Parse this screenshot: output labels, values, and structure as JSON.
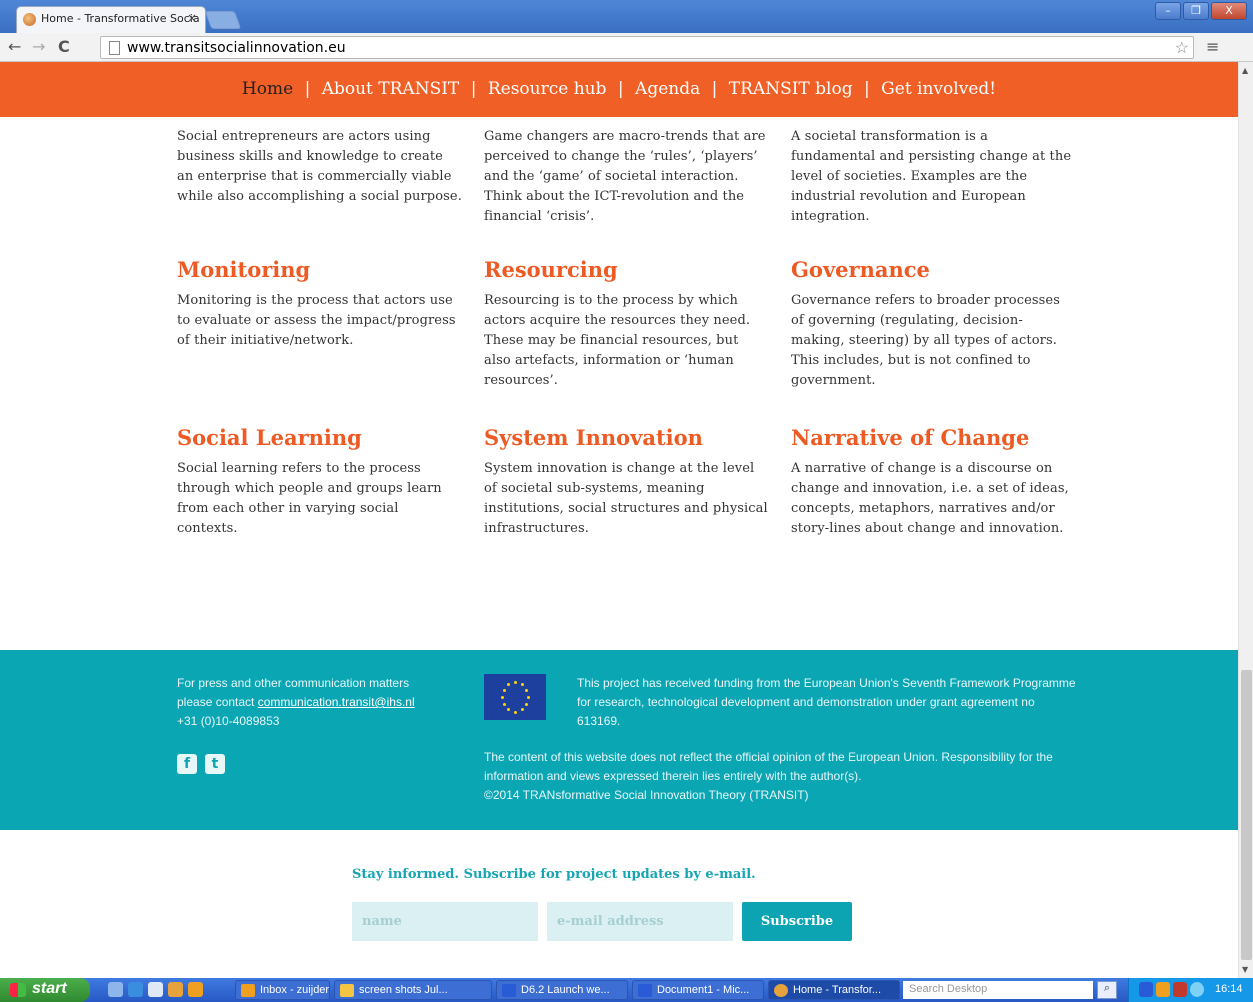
{
  "browser": {
    "tab_title": "Home - Transformative Socia",
    "tab_close": "×",
    "url": "www.transitsocialinnovation.eu",
    "back": "←",
    "forward": "→",
    "reload": "C",
    "star": "☆",
    "menu": "≡",
    "window_minimize": "–",
    "window_restore": "❐",
    "window_close": "X"
  },
  "nav": {
    "items": [
      {
        "label": "Home",
        "active": true
      },
      {
        "label": "About TRANSIT"
      },
      {
        "label": "Resource hub"
      },
      {
        "label": "Agenda"
      },
      {
        "label": "TRANSIT blog"
      },
      {
        "label": "Get involved!"
      }
    ],
    "separator": "|"
  },
  "concepts": {
    "top": [
      {
        "text": "Social entrepreneurs are actors using business skills and knowledge to create an enterprise that is commercially viable while also accomplishing a social purpose."
      },
      {
        "text": "Game changers are macro-trends that are perceived to change the ‘rules’, ‘players’ and the ‘game’ of societal interaction. Think about the ICT-revolution and the financial ‘crisis’."
      },
      {
        "text": "A societal transformation is a fundamental and persisting change at the level of societies. Examples are the industrial revolution and European integration."
      }
    ],
    "middle": [
      {
        "title": "Monitoring",
        "text": "Monitoring is the process that actors use to evaluate or assess the impact/progress of their initiative/network."
      },
      {
        "title": "Resourcing",
        "text": "Resourcing is to the process by which actors acquire the resources they need. These may be financial resources, but also artefacts, information or ‘human resources’."
      },
      {
        "title": "Governance",
        "text": "Governance refers to broader processes of governing (regulating, decision-making, steering) by all types of actors. This includes, but is not confined to government."
      }
    ],
    "bottom": [
      {
        "title": "Social Learning",
        "text": "Social learning refers to the process through which people and groups learn from each other in varying social contexts."
      },
      {
        "title": "System Innovation",
        "text": "System innovation is change at the level of societal sub-systems, meaning institutions, social structures and physical infrastructures."
      },
      {
        "title": "Narrative of Change",
        "text": "A narrative of change is a discourse on change and innovation, i.e. a set of ideas, concepts, metaphors, narratives and/or story-lines about change and innovation."
      }
    ]
  },
  "footer": {
    "contact_line1": "For press and other communication matters",
    "contact_line2_prefix": "please contact ",
    "contact_email": "communication.transit@ihs.nl",
    "contact_phone": "+31 (0)10-4089853",
    "social_facebook": "f",
    "social_twitter": "t",
    "funding": "This project has received funding from the European Union's Seventh Framework Programme for research, technological development and demonstration under grant agreement no 613169.",
    "disclaimer": "The content of this website does not reflect the official opinion of the European Union. Responsibility for the information and views expressed therein lies entirely with the author(s).",
    "copyright": "©2014 TRANsformative Social Innovation Theory (TRANSIT)"
  },
  "subscribe": {
    "title": "Stay informed. Subscribe for project updates by e-mail.",
    "name_placeholder": "name",
    "email_placeholder": "e-mail address",
    "button": "Subscribe"
  },
  "taskbar": {
    "start": "start",
    "tasks": [
      {
        "label": "Inbox - zuijderwi...",
        "color": "#f0a020"
      },
      {
        "label": "screen shots Jul...",
        "color": "#f4c542"
      },
      {
        "label": "D6.2 Launch we...",
        "color": "#2a5bd7"
      },
      {
        "label": "Document1 - Mic...",
        "color": "#2a5bd7"
      },
      {
        "label": "Home - Transfor...",
        "color": "#e6a23c"
      }
    ],
    "search_placeholder": "Search Desktop",
    "clock": "16:14"
  },
  "colors": {
    "nav_bg": "#f05f26",
    "heading": "#ee5a24",
    "footer_bg": "#0aa6b4",
    "subscribe_accent": "#0ca4b2"
  }
}
